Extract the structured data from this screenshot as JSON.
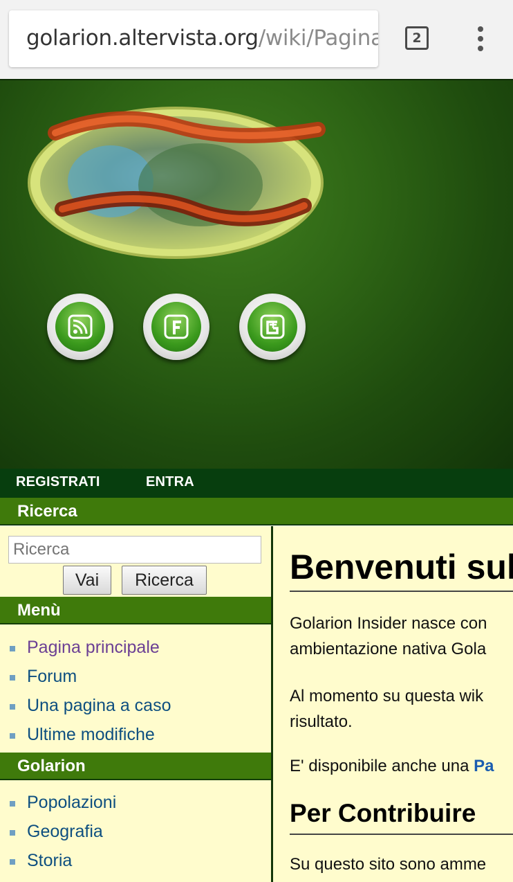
{
  "browser": {
    "url_host": "golarion.altervista.org",
    "url_path": "/wiki/Pagina_",
    "tab_count": "2"
  },
  "logo": {
    "name": "Golarion Insider logo"
  },
  "social_icons": [
    "rss-icon",
    "facebook-icon",
    "google-plus-icon"
  ],
  "user_bar": {
    "register": "REGISTRATI",
    "login": "ENTRA"
  },
  "search": {
    "title": "Ricerca",
    "placeholder": "Ricerca",
    "go_label": "Vai",
    "search_label": "Ricerca"
  },
  "menu": {
    "title": "Menù",
    "items": [
      {
        "label": "Pagina principale",
        "visited": true
      },
      {
        "label": "Forum"
      },
      {
        "label": "Una pagina a caso"
      },
      {
        "label": "Ultime modifiche"
      }
    ]
  },
  "golarion": {
    "title": "Golarion",
    "items": [
      {
        "label": "Popolazioni"
      },
      {
        "label": "Geografia"
      },
      {
        "label": "Storia"
      }
    ]
  },
  "content": {
    "heading": "Benvenuti sul",
    "para1_line1": "Golarion Insider nasce con",
    "para1_line2": "ambientazione nativa Gola",
    "para2_line1": "Al momento su questa wik",
    "para2_line2": "risultato.",
    "para3_text": "E' disponibile anche una ",
    "para3_link": "Pa",
    "subheading": "Per Contribuire",
    "para4": "Su questo sito sono amme"
  },
  "colors": {
    "banner_green": "#2e6515",
    "portlet_header": "#3f7a0b",
    "user_bar": "#073e0e",
    "sidebar_bg": "#fffccd",
    "link_blue": "#0e4f80",
    "link_visited": "#6b3f94"
  }
}
